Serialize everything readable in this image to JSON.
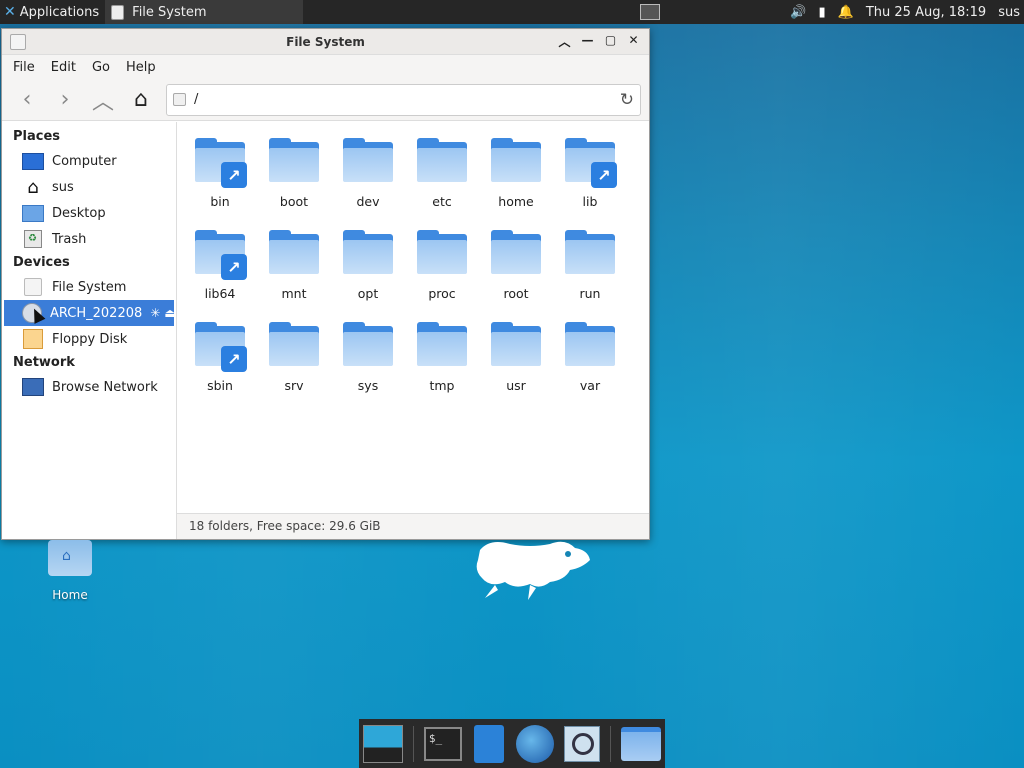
{
  "panel": {
    "applications_label": "Applications",
    "task_title": "File System",
    "clock": "Thu 25 Aug, 18:19",
    "user": "sus"
  },
  "window": {
    "title": "File System",
    "menu": [
      "File",
      "Edit",
      "Go",
      "Help"
    ],
    "path": "/",
    "sidebar": {
      "places_header": "Places",
      "places": [
        "Computer",
        "sus",
        "Desktop",
        "Trash"
      ],
      "devices_header": "Devices",
      "devices": [
        "File System",
        "ARCH_202208",
        "Floppy Disk"
      ],
      "network_header": "Network",
      "network": [
        "Browse Network"
      ],
      "selected": "ARCH_202208"
    },
    "folders": [
      {
        "name": "bin",
        "link": true
      },
      {
        "name": "boot",
        "link": false
      },
      {
        "name": "dev",
        "link": false
      },
      {
        "name": "etc",
        "link": false
      },
      {
        "name": "home",
        "link": false
      },
      {
        "name": "lib",
        "link": true
      },
      {
        "name": "lib64",
        "link": true
      },
      {
        "name": "mnt",
        "link": false
      },
      {
        "name": "opt",
        "link": false
      },
      {
        "name": "proc",
        "link": false
      },
      {
        "name": "root",
        "link": false
      },
      {
        "name": "run",
        "link": false
      },
      {
        "name": "sbin",
        "link": true
      },
      {
        "name": "srv",
        "link": false
      },
      {
        "name": "sys",
        "link": false
      },
      {
        "name": "tmp",
        "link": false
      },
      {
        "name": "usr",
        "link": false
      },
      {
        "name": "var",
        "link": false
      }
    ],
    "status": "18 folders, Free space: 29.6 GiB"
  },
  "desktop": {
    "home_icon_label": "Home"
  },
  "colors": {
    "accent": "#3b7dd8",
    "folder": "#3f8ae0",
    "desktop": "#0e97c8"
  }
}
